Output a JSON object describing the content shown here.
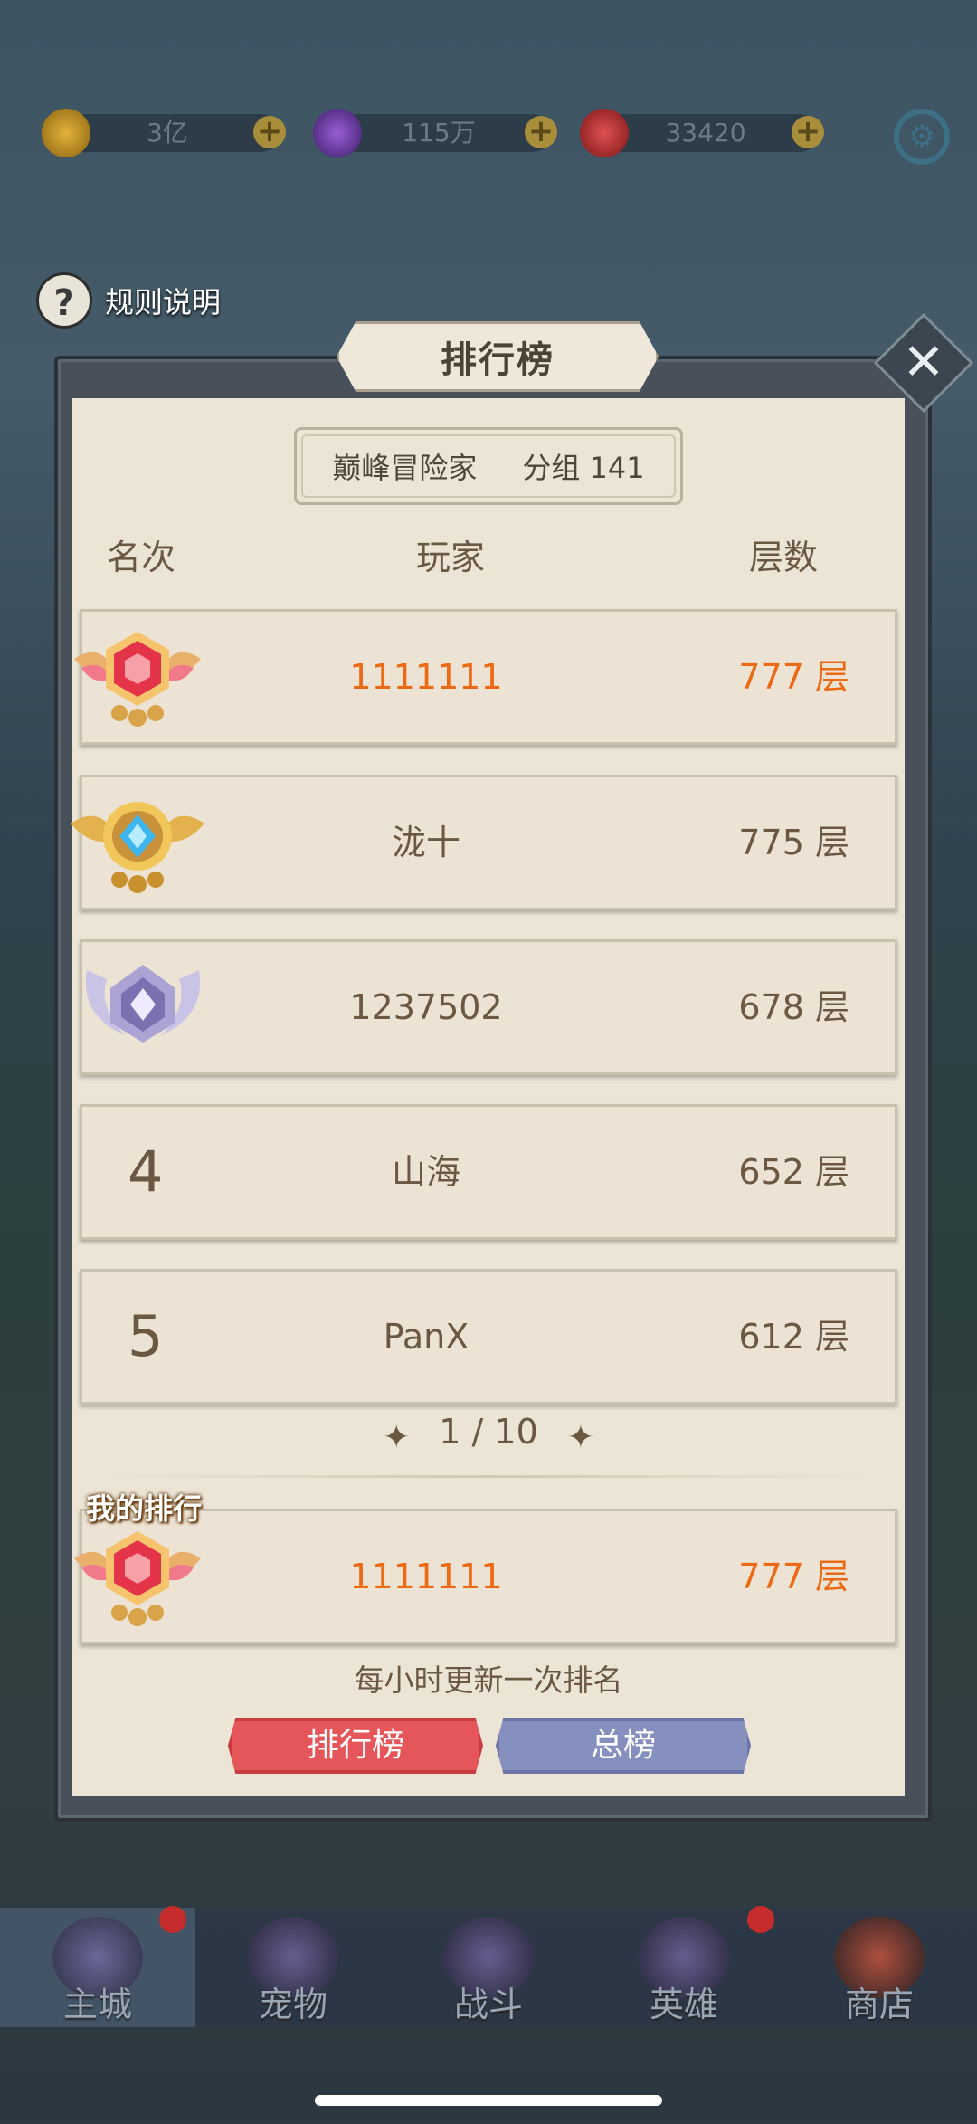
{
  "resources": [
    {
      "name": "gold",
      "value": "3亿",
      "icon": "gold-coin-icon",
      "color": "#d9a21a"
    },
    {
      "name": "crystal",
      "value": "115万",
      "icon": "purple-crystal-icon",
      "color": "#7b3cc9"
    },
    {
      "name": "gem",
      "value": "33420",
      "icon": "red-gem-icon",
      "color": "#d62a35"
    }
  ],
  "rules": {
    "label": "规则说明"
  },
  "panel": {
    "title": "排行榜",
    "group": {
      "name": "巅峰冒险家",
      "group_label": "分组 141"
    },
    "headers": {
      "rank": "名次",
      "player": "玩家",
      "floors": "层数"
    },
    "rows": [
      {
        "rank": "1",
        "medal": "ruby-medal-icon",
        "player": "1111111",
        "floors": "777 层",
        "highlight": true
      },
      {
        "rank": "2",
        "medal": "sapphire-medal-icon",
        "player": "泷十",
        "floors": "775 层",
        "highlight": false
      },
      {
        "rank": "3",
        "medal": "silver-medal-icon",
        "player": "1237502",
        "floors": "678 层",
        "highlight": false
      },
      {
        "rank": "4",
        "medal": "",
        "player": "山海",
        "floors": "652 层",
        "highlight": false
      },
      {
        "rank": "5",
        "medal": "",
        "player": "PanX",
        "floors": "612 层",
        "highlight": false
      }
    ],
    "pager": {
      "current": "1 / 10"
    },
    "my_rank": {
      "label": "我的排行",
      "medal": "ruby-medal-icon",
      "player": "1111111",
      "floors": "777 层"
    },
    "update_note": "每小时更新一次排名",
    "tabs": {
      "ranking": "排行榜",
      "overall": "总榜"
    }
  },
  "nav": [
    {
      "label": "主城",
      "active": true,
      "badge": true
    },
    {
      "label": "宠物",
      "active": false,
      "badge": false
    },
    {
      "label": "战斗",
      "active": false,
      "badge": false
    },
    {
      "label": "英雄",
      "active": false,
      "badge": true
    },
    {
      "label": "商店",
      "active": false,
      "badge": false
    }
  ],
  "colors": {
    "accent_orange": "#ec6a13",
    "text_brown": "#6a5842",
    "tab_red": "#e5565a",
    "tab_blue": "#8690be"
  }
}
